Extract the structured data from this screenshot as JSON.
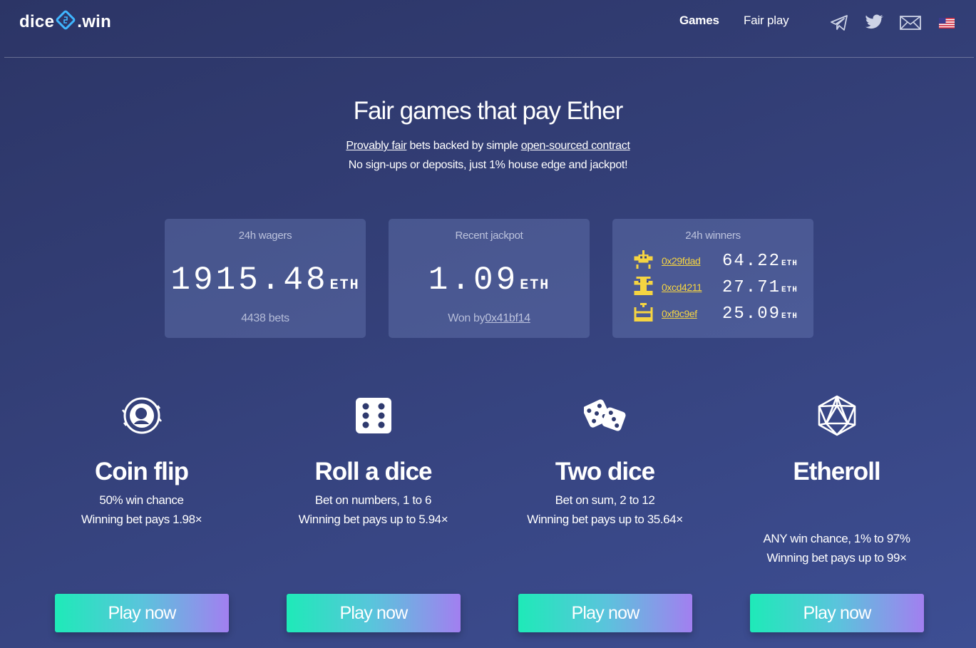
{
  "header": {
    "logo_left": "dice",
    "logo_right": ".win",
    "nav": {
      "games": "Games",
      "fair_play": "Fair play"
    },
    "icons": [
      "telegram-icon",
      "twitter-icon",
      "mail-icon",
      "us-flag-icon"
    ]
  },
  "hero": {
    "title": "Fair games that pay Ether",
    "sub_link1": "Provably fair",
    "sub_mid": " bets backed by simple ",
    "sub_link2": "open-sourced contract",
    "sub_line2": "No sign-ups or deposits, just 1% house edge and jackpot!"
  },
  "stats": {
    "wagers": {
      "title": "24h wagers",
      "value": "1915.48",
      "unit": "ETH",
      "foot": "4438 bets"
    },
    "jackpot": {
      "title": "Recent jackpot",
      "value": "1.09",
      "unit": "ETH",
      "foot_prefix": "Won by",
      "winner": "0x41bf14"
    },
    "winners": {
      "title": "24h winners",
      "list": [
        {
          "address": "0x29fdad",
          "amount": "64.22",
          "unit": "ETH"
        },
        {
          "address": "0xcd4211",
          "amount": "27.71",
          "unit": "ETH"
        },
        {
          "address": "0xf9c9ef",
          "amount": "25.09",
          "unit": "ETH"
        }
      ]
    }
  },
  "games": [
    {
      "name": "Coin flip",
      "line1": "50% win chance",
      "line2": "Winning bet pays 1.98×",
      "button": "Play now",
      "icon": "coin-icon"
    },
    {
      "name": "Roll a dice",
      "line1": "Bet on numbers, 1 to 6",
      "line2": "Winning bet pays up to 5.94×",
      "button": "Play now",
      "icon": "die-icon"
    },
    {
      "name": "Two dice",
      "line1": "Bet on sum, 2 to 12",
      "line2": "Winning bet pays up to 35.64×",
      "button": "Play now",
      "icon": "two-dice-icon"
    },
    {
      "name": "Etheroll",
      "line1": "ANY win chance, 1% to 97%",
      "line2": "Winning bet pays up to 99×",
      "button": "Play now",
      "icon": "icosahedron-icon"
    }
  ],
  "colors": {
    "accent_address": "#f5d442",
    "button_start": "#1eeab8",
    "button_end": "#a27ff0"
  }
}
